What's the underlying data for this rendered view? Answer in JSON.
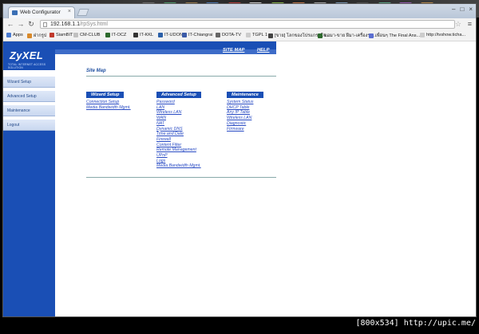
{
  "browser": {
    "tab_title": "Web Configurator",
    "url_host": "192.168.1.1",
    "url_path": "/rpSys.html",
    "bookmarks": [
      {
        "label": "Apps",
        "color": "#4a7bd0"
      },
      {
        "label": "ฝากรูป",
        "color": "#d98a2b"
      },
      {
        "label": "SiamBIT",
        "color": "#c0392b"
      },
      {
        "label": "CM-CLUB",
        "color": "#c0c0c0"
      },
      {
        "label": "IT-OCZ",
        "color": "#2d6a2d"
      },
      {
        "label": "IT-KKL",
        "color": "#333333"
      },
      {
        "label": "IT-UDON",
        "color": "#2a5fa8"
      },
      {
        "label": "IT-Chiangrai",
        "color": "#3b5ba8"
      },
      {
        "label": "DOTA-TV",
        "color": "#666666"
      },
      {
        "label": "TGPL 1",
        "color": "#cccccc"
      },
      {
        "label": "[ขาย] โลกของโปรแกรมใจ...",
        "color": "#444444"
      },
      {
        "label": "ขอมา-ขาย ฝีมา-เครื่องรา...",
        "color": "#2d6a2d"
      },
      {
        "label": "เพื่อนๆ The Final Ans...",
        "color": "#5b6ed1"
      },
      {
        "label": "http://tvshow.ticha...",
        "color": "#cccccc"
      }
    ]
  },
  "router": {
    "brand": "ZyXEL",
    "tagline": "TOTAL INTERNET ACCESS SOLUTION",
    "sidebar": [
      "Wizard Setup",
      "Advanced Setup",
      "Maintenance",
      "Logout"
    ],
    "top_links": {
      "site_map": "SITE MAP",
      "help": "HELP"
    },
    "page_title": "Site Map",
    "columns": [
      {
        "heading": "Wizard Setup",
        "links": [
          "Connection Setup",
          "Media Bandwidth Mgmt."
        ]
      },
      {
        "heading": "Advanced Setup",
        "links": [
          "Password",
          "LAN",
          "Wireless LAN",
          "WAN",
          "NAT",
          "Dynamic DNS",
          "Time and Date",
          "Firewall",
          "Content Filter",
          "Remote Management",
          "UPnP",
          "Logs",
          "Media Bandwidth Mgmt."
        ]
      },
      {
        "heading": "Maintenance",
        "links": [
          "System Status",
          "DHCP Table",
          "Any IP Table",
          "Wireless LAN",
          "Diagnostic",
          "Firmware"
        ]
      }
    ]
  },
  "watermark": "[800x534] http://upic.me/"
}
